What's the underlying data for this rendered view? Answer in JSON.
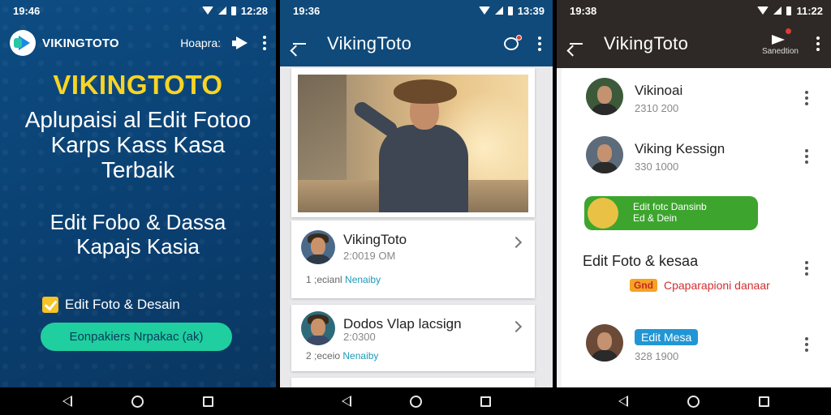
{
  "panel1": {
    "status": {
      "time": "19:46",
      "clock": "12:28"
    },
    "brand": "VIKINGTOTO",
    "search_label": "Hoapra:",
    "hero_title": "VIKINGTOTO",
    "hero_sub": "Aplupaisi al Edit Fotoo Karps Kass Kasa Terbaik",
    "hero_sub2": "Edit Fobo & Dassa Kapajs Kasia",
    "feature_label": "Edit Foto & Desain",
    "cta_label": "Eonpakiers Nrpakac (ak)"
  },
  "panel2": {
    "status": {
      "time": "19:36",
      "clock": "13:39"
    },
    "title": "VikingToto",
    "items": [
      {
        "name": "VikingToto",
        "meta": "2:0019 OM",
        "sub_prefix": "1 ;ecianl",
        "sub_accent": "Nenaiby"
      },
      {
        "name": "Dodos Vlap lacsign",
        "meta": "2:0300",
        "sub_prefix": "2 ;eceio",
        "sub_accent": "Nenaiby"
      }
    ]
  },
  "panel3": {
    "status": {
      "time": "19:38",
      "clock": "11:22"
    },
    "title": "VikingToto",
    "sub_label": "Sanedtion",
    "rows": [
      {
        "name": "Vikinoai",
        "meta": "2310 200"
      },
      {
        "name": "Viking Kessign",
        "meta": "330 1000"
      }
    ],
    "green_item": {
      "line1": "Edit fotc Dansinb",
      "line2": "Ed & Dein"
    },
    "section_title": "Edit Foto & kesaa",
    "badge_orange": "Gnd",
    "red_text": "Cpaparapioni danaar",
    "blue_badge": "Edit Mesa",
    "blue_meta": "328 1900"
  }
}
